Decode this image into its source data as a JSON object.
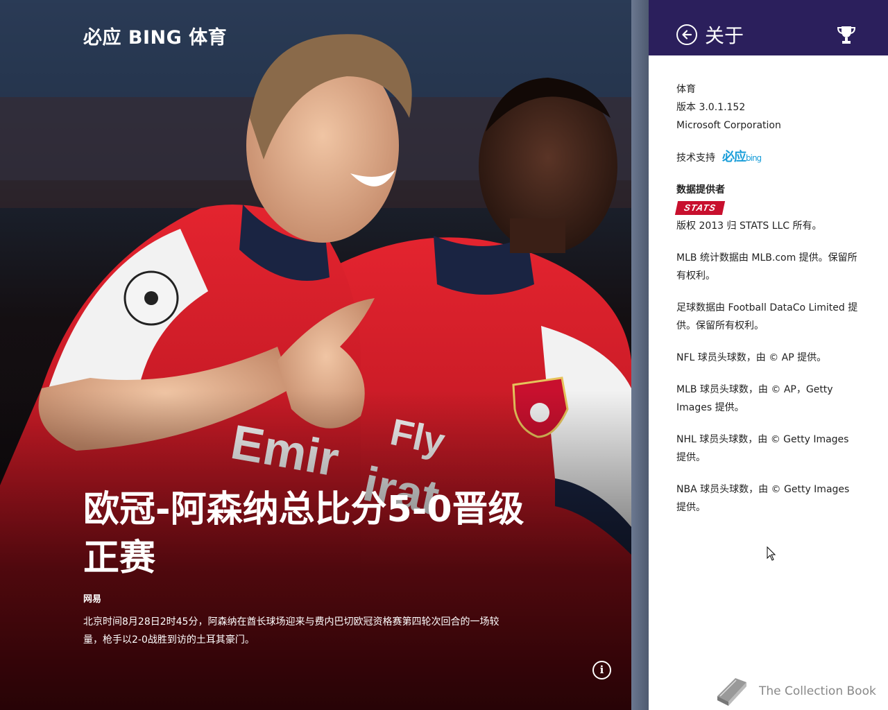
{
  "hero": {
    "app_title": "必应 BING 体育",
    "headline": "欧冠-阿森纳总比分5-0晋级正赛",
    "source": "网易",
    "summary": "北京时间8月28日2时45分，阿森纳在酋长球场迎来与费内巴切欧冠资格赛第四轮次回合的一场较量，枪手以2-0战胜到访的土耳其豪门。",
    "info_icon_glyph": "i"
  },
  "about": {
    "title": "关于",
    "app_name": "体育",
    "version": "版本 3.0.1.152",
    "company": "Microsoft Corporation",
    "support_label": "技术支持",
    "bing_logo_text": "必应",
    "bing_logo_small": "bing",
    "data_provider_label": "数据提供者",
    "stats_logo_text": "STATS",
    "copyright": "版权 2013 归 STATS LLC 所有。",
    "mlb_stats": "MLB 统计数据由 MLB.com 提供。保留所有权利。",
    "soccer_data": "足球数据由 Football DataCo Limited 提供。保留所有权利。",
    "nfl_headshots": "NFL 球员头球数，由 © AP 提供。",
    "mlb_headshots": "MLB 球员头球数，由 © AP，Getty Images 提供。",
    "nhl_headshots": "NHL 球员头球数，由 © Getty Images 提供。",
    "nba_headshots": "NBA 球员头球数，由 © Getty Images 提供。"
  },
  "watermark": {
    "text": "The Collection Book"
  },
  "colors": {
    "pane_header": "#2b1f5c",
    "jersey_red": "#d7152a",
    "bing_blue": "#1a9ed9",
    "stats_red": "#c8102e"
  },
  "icons": [
    "back-arrow-icon",
    "trophy-icon",
    "info-icon",
    "book-icon",
    "mouse-cursor-icon"
  ]
}
